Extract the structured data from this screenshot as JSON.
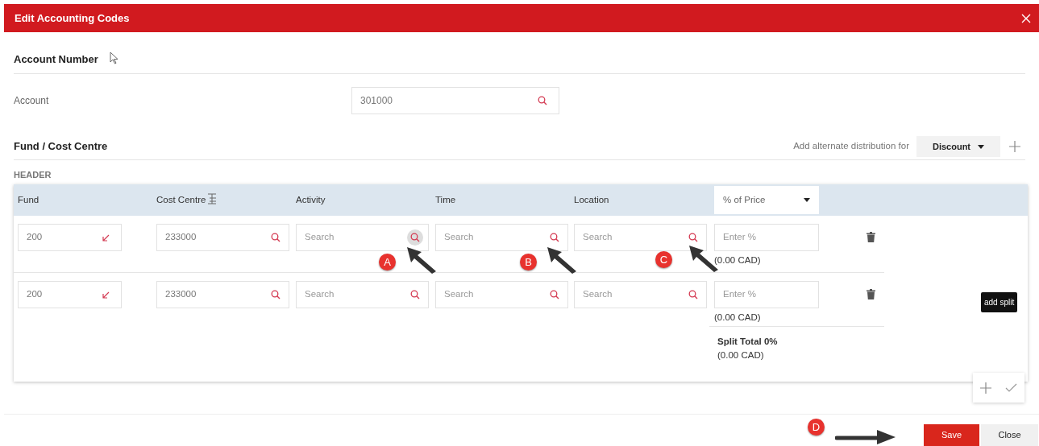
{
  "dialog": {
    "title": "Edit Accounting Codes"
  },
  "account_section": {
    "heading": "Account Number",
    "label": "Account",
    "value": "301000"
  },
  "distribution": {
    "heading": "Fund / Cost Centre",
    "alt_label": "Add alternate distribution for",
    "alt_select": "Discount"
  },
  "header_label": "HEADER",
  "table": {
    "columns": [
      {
        "label": "Fund"
      },
      {
        "label": "Cost Centre"
      },
      {
        "label": "Activity"
      },
      {
        "label": "Time"
      },
      {
        "label": "Location"
      }
    ],
    "amount_type": "% of Price",
    "rows": [
      {
        "cells": [
          {
            "kind": "fund",
            "value": "200"
          },
          {
            "kind": "search",
            "value": "233000",
            "icon_hovered": false
          },
          {
            "kind": "search",
            "placeholder": "Search",
            "icon_hovered": true
          },
          {
            "kind": "search",
            "placeholder": "Search",
            "icon_hovered": false
          },
          {
            "kind": "search",
            "placeholder": "Search",
            "icon_hovered": false
          }
        ],
        "percent_placeholder": "Enter %",
        "amount": "(0.00 CAD)"
      },
      {
        "cells": [
          {
            "kind": "fund",
            "value": "200"
          },
          {
            "kind": "search",
            "value": "233000",
            "icon_hovered": false
          },
          {
            "kind": "search",
            "placeholder": "Search",
            "icon_hovered": false
          },
          {
            "kind": "search",
            "placeholder": "Search",
            "icon_hovered": false
          },
          {
            "kind": "search",
            "placeholder": "Search",
            "icon_hovered": false
          }
        ],
        "percent_placeholder": "Enter %",
        "amount": "(0.00 CAD)"
      }
    ],
    "split_total": {
      "label": "Split Total 0%",
      "amount": "(0.00 CAD)"
    }
  },
  "tooltip": "add split",
  "buttons": [
    {
      "label": "Save",
      "kind": "primary"
    },
    {
      "label": "Close",
      "kind": "secondary"
    }
  ],
  "annotations": [
    {
      "label": "A"
    },
    {
      "label": "B"
    },
    {
      "label": "C"
    },
    {
      "label": "D"
    }
  ]
}
